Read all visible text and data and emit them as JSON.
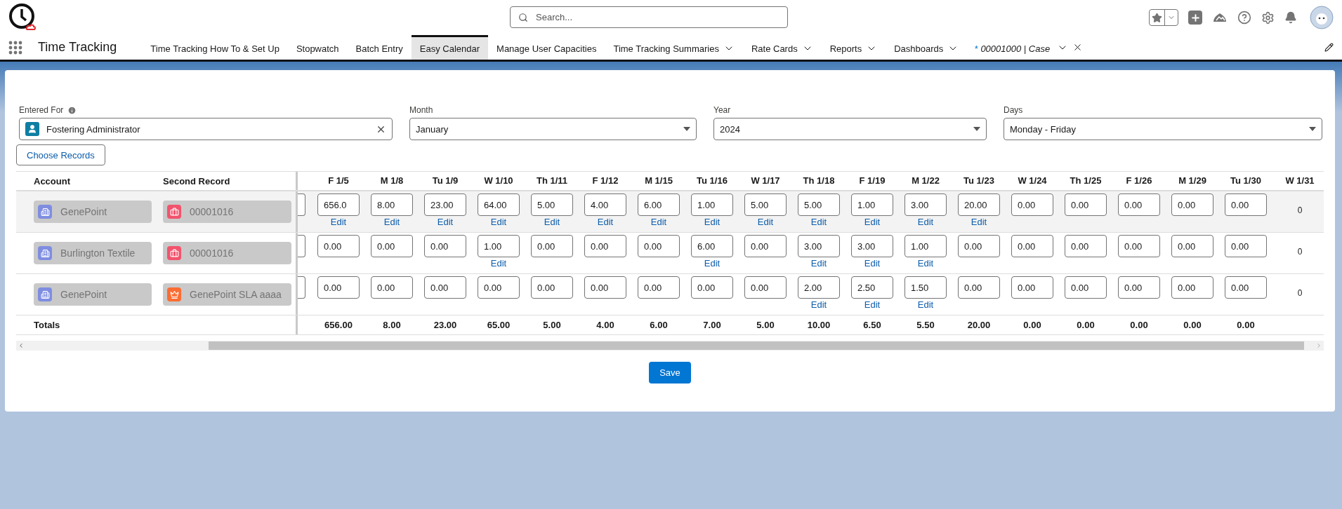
{
  "header": {
    "search": {
      "placeholder": "Search..."
    }
  },
  "nav": {
    "app_name": "Time Tracking",
    "tabs": [
      {
        "label": "Time Tracking How To & Set Up",
        "selected": false,
        "dropdown": false
      },
      {
        "label": "Stopwatch",
        "selected": false,
        "dropdown": false
      },
      {
        "label": "Batch Entry",
        "selected": false,
        "dropdown": false
      },
      {
        "label": "Easy Calendar",
        "selected": true,
        "dropdown": false
      },
      {
        "label": "Manage User Capacities",
        "selected": false,
        "dropdown": false
      },
      {
        "label": "Time Tracking Summaries",
        "selected": false,
        "dropdown": true
      },
      {
        "label": "Rate Cards",
        "selected": false,
        "dropdown": true
      },
      {
        "label": "Reports",
        "selected": false,
        "dropdown": true
      },
      {
        "label": "Dashboards",
        "selected": false,
        "dropdown": true
      }
    ],
    "record_tab": {
      "marker": "*",
      "label": "00001000 | Case"
    }
  },
  "filters": [
    {
      "kind": "lookup",
      "label": "Entered For",
      "value": "Fostering Administrator"
    },
    {
      "kind": "select",
      "label": "Month",
      "value": "January"
    },
    {
      "kind": "select",
      "label": "Year",
      "value": "2024"
    },
    {
      "kind": "select",
      "label": "Days",
      "value": "Monday - Friday"
    }
  ],
  "choose_button": "Choose Records",
  "table": {
    "columns": [
      "Account",
      "Second Record"
    ],
    "days": [
      "F 1/5",
      "M 1/8",
      "Tu 1/9",
      "W 1/10",
      "Th 1/11",
      "F 1/12",
      "M 1/15",
      "Tu 1/16",
      "W 1/17",
      "Th 1/18",
      "F 1/19",
      "M 1/22",
      "Tu 1/23",
      "W 1/24",
      "Th 1/25",
      "F 1/26",
      "M 1/29",
      "Tu 1/30",
      "W 1/31"
    ],
    "rows": [
      {
        "highlighted": true,
        "account": "GenePoint",
        "second_record": {
          "kind": "case",
          "label": "00001016"
        },
        "cells": [
          {
            "kind": "input",
            "value": "656.0",
            "edit": "Edit"
          },
          {
            "kind": "input",
            "value": "8.00",
            "edit": "Edit"
          },
          {
            "kind": "input",
            "value": "23.00",
            "edit": "Edit"
          },
          {
            "kind": "input",
            "value": "64.00",
            "edit": "Edit"
          },
          {
            "kind": "input",
            "value": "5.00",
            "edit": "Edit"
          },
          {
            "kind": "input",
            "value": "4.00",
            "edit": "Edit"
          },
          {
            "kind": "input",
            "value": "6.00",
            "edit": "Edit"
          },
          {
            "kind": "input",
            "value": "1.00",
            "edit": "Edit"
          },
          {
            "kind": "input",
            "value": "5.00",
            "edit": "Edit"
          },
          {
            "kind": "input",
            "value": "5.00",
            "edit": "Edit"
          },
          {
            "kind": "input",
            "value": "1.00",
            "edit": "Edit"
          },
          {
            "kind": "input",
            "value": "3.00",
            "edit": "Edit"
          },
          {
            "kind": "input",
            "value": "20.00",
            "edit": "Edit"
          },
          {
            "kind": "input",
            "value": "0.00"
          },
          {
            "kind": "input",
            "value": "0.00"
          },
          {
            "kind": "input",
            "value": "0.00"
          },
          {
            "kind": "input",
            "value": "0.00"
          },
          {
            "kind": "input",
            "value": "0.00"
          },
          {
            "kind": "text",
            "value": "0"
          }
        ]
      },
      {
        "highlighted": false,
        "account": "Burlington Textile",
        "second_record": {
          "kind": "case",
          "label": "00001016"
        },
        "cells": [
          {
            "kind": "input",
            "value": "0.00"
          },
          {
            "kind": "input",
            "value": "0.00"
          },
          {
            "kind": "input",
            "value": "0.00"
          },
          {
            "kind": "input",
            "value": "1.00",
            "edit": "Edit"
          },
          {
            "kind": "input",
            "value": "0.00"
          },
          {
            "kind": "input",
            "value": "0.00"
          },
          {
            "kind": "input",
            "value": "0.00"
          },
          {
            "kind": "input",
            "value": "6.00",
            "edit": "Edit"
          },
          {
            "kind": "input",
            "value": "0.00"
          },
          {
            "kind": "input",
            "value": "3.00",
            "edit": "Edit"
          },
          {
            "kind": "input",
            "value": "3.00",
            "edit": "Edit"
          },
          {
            "kind": "input",
            "value": "1.00",
            "edit": "Edit"
          },
          {
            "kind": "input",
            "value": "0.00"
          },
          {
            "kind": "input",
            "value": "0.00"
          },
          {
            "kind": "input",
            "value": "0.00"
          },
          {
            "kind": "input",
            "value": "0.00"
          },
          {
            "kind": "input",
            "value": "0.00"
          },
          {
            "kind": "input",
            "value": "0.00"
          },
          {
            "kind": "text",
            "value": "0"
          }
        ]
      },
      {
        "highlighted": false,
        "account": "GenePoint",
        "second_record": {
          "kind": "entitlement",
          "label": "GenePoint SLA aaaa"
        },
        "cells": [
          {
            "kind": "input",
            "value": "0.00"
          },
          {
            "kind": "input",
            "value": "0.00"
          },
          {
            "kind": "input",
            "value": "0.00"
          },
          {
            "kind": "input",
            "value": "0.00"
          },
          {
            "kind": "input",
            "value": "0.00"
          },
          {
            "kind": "input",
            "value": "0.00"
          },
          {
            "kind": "input",
            "value": "0.00"
          },
          {
            "kind": "input",
            "value": "0.00"
          },
          {
            "kind": "input",
            "value": "0.00"
          },
          {
            "kind": "input",
            "value": "2.00",
            "edit": "Edit"
          },
          {
            "kind": "input",
            "value": "2.50",
            "edit": "Edit"
          },
          {
            "kind": "input",
            "value": "1.50",
            "edit": "Edit"
          },
          {
            "kind": "input",
            "value": "0.00"
          },
          {
            "kind": "input",
            "value": "0.00"
          },
          {
            "kind": "input",
            "value": "0.00"
          },
          {
            "kind": "input",
            "value": "0.00"
          },
          {
            "kind": "input",
            "value": "0.00"
          },
          {
            "kind": "input",
            "value": "0.00"
          },
          {
            "kind": "text",
            "value": "0"
          }
        ]
      }
    ],
    "totals_label": "Totals",
    "totals": [
      "656.00",
      "8.00",
      "23.00",
      "65.00",
      "5.00",
      "4.00",
      "6.00",
      "7.00",
      "5.00",
      "10.00",
      "6.50",
      "5.50",
      "20.00",
      "0.00",
      "0.00",
      "0.00",
      "0.00",
      "0.00"
    ]
  },
  "save_button": "Save"
}
